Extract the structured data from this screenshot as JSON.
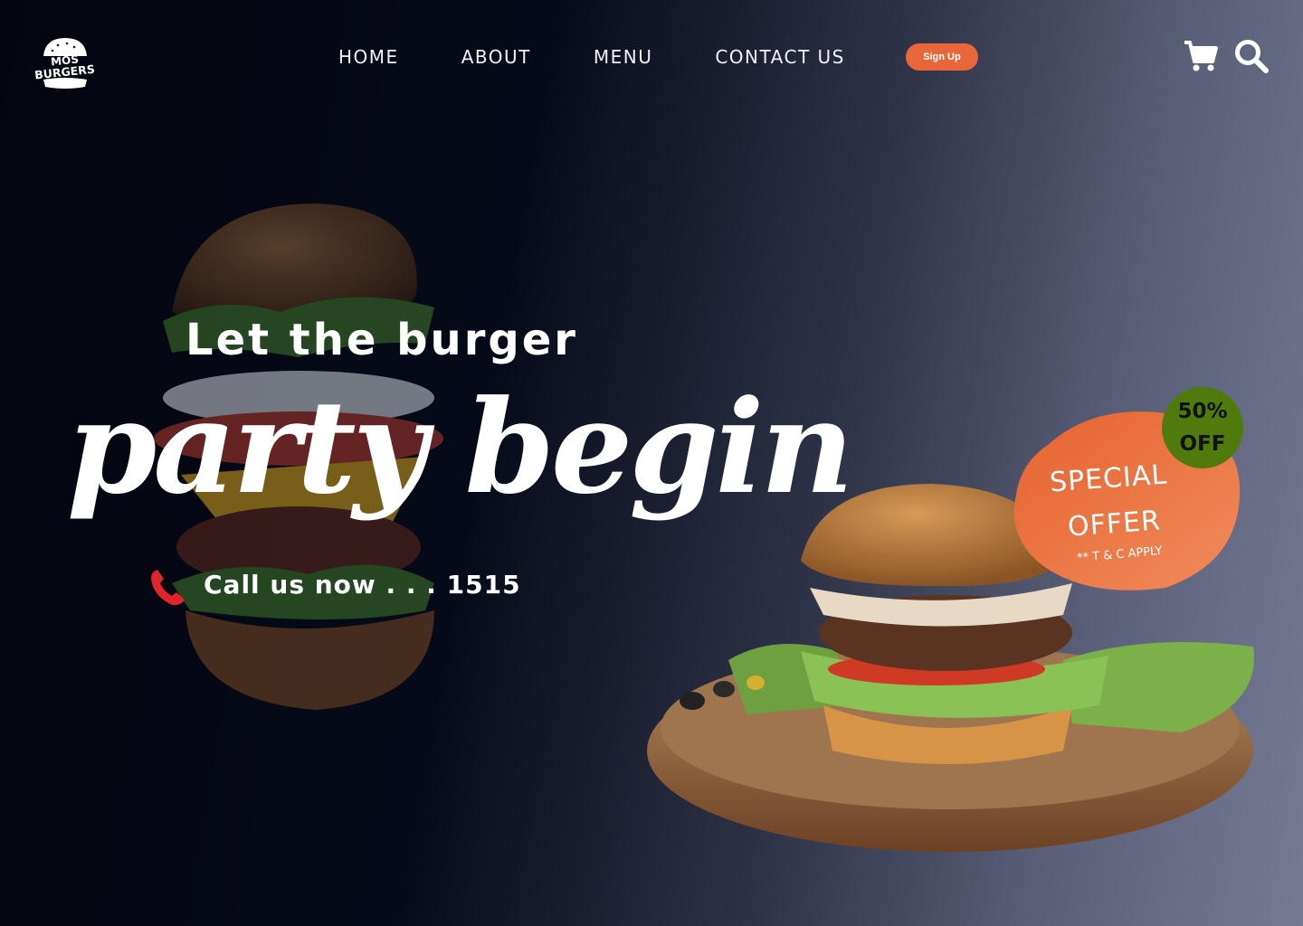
{
  "brand": {
    "logo_text_line1": "MOS",
    "logo_text_line2": "BURGERS"
  },
  "nav": {
    "items": [
      "HOME",
      "ABOUT",
      "MENU",
      "CONTACT US"
    ],
    "signup_label": "Sign Up"
  },
  "icons": {
    "cart": "cart-icon",
    "search": "search-icon",
    "phone": "phone-icon"
  },
  "hero": {
    "headline": "Let the burger",
    "script_text": "party begin",
    "call_text": "Call us now . . .  1515"
  },
  "offer": {
    "line1": "SPECIAL",
    "line2": "OFFER",
    "terms": "** T & C APPLY",
    "discount_line1": "50%",
    "discount_line2": "OFF"
  },
  "colors": {
    "accent": "#e8673a",
    "discount_badge": "#4f7a0c",
    "phone_icon": "#e0242a"
  }
}
